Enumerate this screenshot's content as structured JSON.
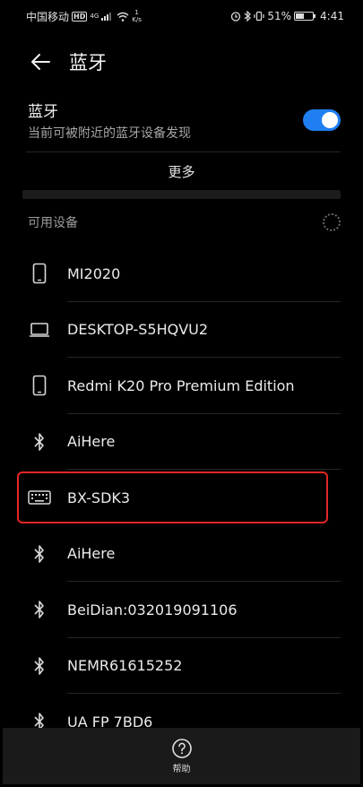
{
  "statusbar": {
    "carrier": "中国移动",
    "hd": "HD",
    "net_type": "4G",
    "speed_value": "1",
    "speed_unit": "K/s",
    "battery": "51%",
    "time": "4:41"
  },
  "header": {
    "title": "蓝牙"
  },
  "bluetooth": {
    "label": "蓝牙",
    "subtitle": "当前可被附近的蓝牙设备发现",
    "enabled": true,
    "accent": "#1f7ff2"
  },
  "more_label": "更多",
  "available": {
    "title": "可用设备",
    "devices": [
      {
        "name": "MI2020",
        "icon": "phone-icon"
      },
      {
        "name": "DESKTOP-S5HQVU2",
        "icon": "laptop-icon"
      },
      {
        "name": "Redmi K20 Pro Premium Edition",
        "icon": "phone-icon"
      },
      {
        "name": "AiHere",
        "icon": "bluetooth-icon"
      },
      {
        "name": "BX-SDK3",
        "icon": "keyboard-icon",
        "highlighted": true
      },
      {
        "name": "AiHere",
        "icon": "bluetooth-icon"
      },
      {
        "name": "BeiDian:032019091106",
        "icon": "bluetooth-icon"
      },
      {
        "name": "NEMR61615252",
        "icon": "bluetooth-icon"
      },
      {
        "name": "UA FP 7BD6",
        "icon": "bluetooth-icon"
      }
    ]
  },
  "footer": {
    "help_label": "帮助"
  },
  "highlight_color": "#e32626"
}
